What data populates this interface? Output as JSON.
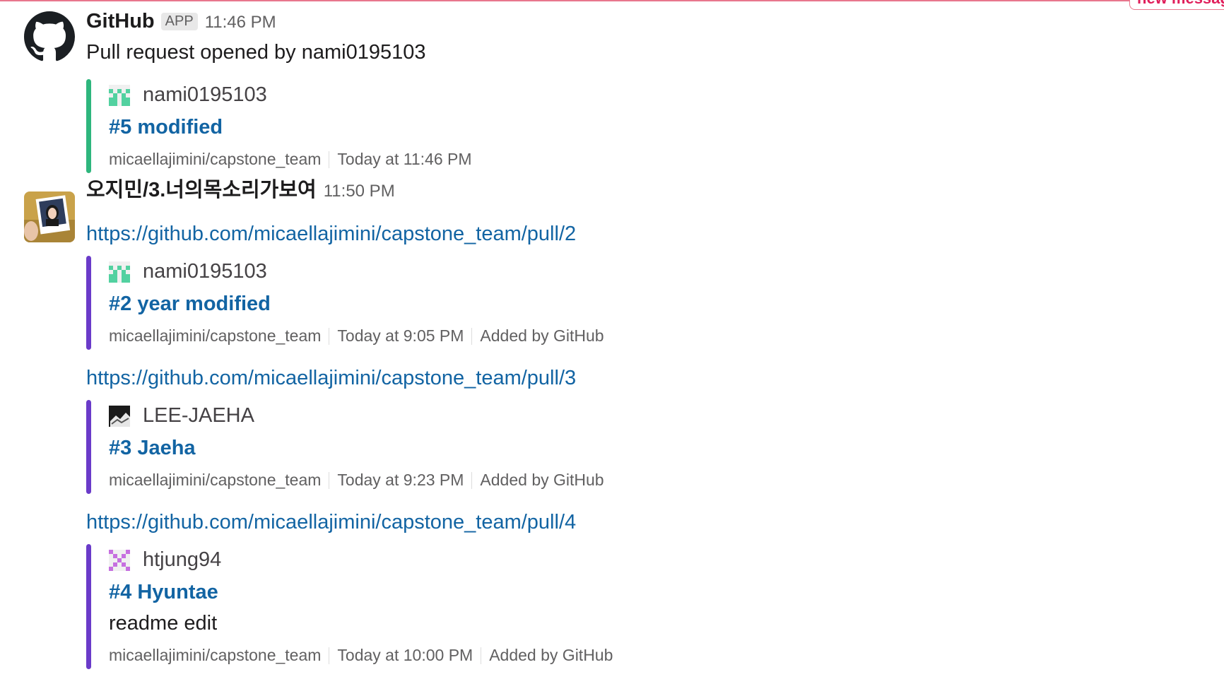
{
  "new_messages_label": "new messag",
  "colors": {
    "link": "#1264a3",
    "bar_green": "#2eb67d",
    "bar_purple": "#6a3bc9",
    "new_divider": "#e8768d"
  },
  "messages": [
    {
      "sender": "GitHub",
      "badge": "APP",
      "time": "11:46 PM",
      "avatar_icon": "github-octocat-icon",
      "text": "Pull request opened by nami0195103",
      "attachment": {
        "author": "nami0195103",
        "author_icon": "identicon-green",
        "title": "#5 modified",
        "repo": "micaellajimini/capstone_team",
        "timestamp": "Today at 11:46 PM"
      }
    },
    {
      "sender": "오지민/3.너의목소리가보여",
      "time": "11:50 PM",
      "avatar_icon": "user-photo-avatar",
      "links": [
        {
          "url": "https://github.com/micaellajimini/capstone_team/pull/2",
          "attachment": {
            "author": "nami0195103",
            "author_icon": "identicon-green",
            "title": "#2 year modified",
            "repo": "micaellajimini/capstone_team",
            "timestamp": "Today at 9:05 PM",
            "added_by": "Added by GitHub"
          }
        },
        {
          "url": "https://github.com/micaellajimini/capstone_team/pull/3",
          "attachment": {
            "author": "LEE-JAEHA",
            "author_icon": "photo-dark",
            "title": "#3 Jaeha",
            "repo": "micaellajimini/capstone_team",
            "timestamp": "Today at 9:23 PM",
            "added_by": "Added by GitHub"
          }
        },
        {
          "url": "https://github.com/micaellajimini/capstone_team/pull/4",
          "attachment": {
            "author": "htjung94",
            "author_icon": "identicon-purple",
            "title": "#4 Hyuntae",
            "description": "readme edit",
            "repo": "micaellajimini/capstone_team",
            "timestamp": "Today at 10:00 PM",
            "added_by": "Added by GitHub"
          }
        }
      ]
    }
  ]
}
